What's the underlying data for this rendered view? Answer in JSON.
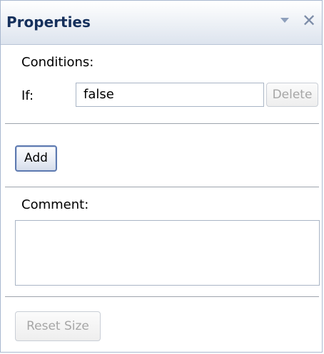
{
  "panel": {
    "title": "Properties"
  },
  "conditions": {
    "heading": "Conditions:",
    "if_label": "If:",
    "if_value": "false",
    "delete_label": "Delete"
  },
  "actions": {
    "add_label": "Add"
  },
  "comment": {
    "heading": "Comment:",
    "value": ""
  },
  "footer": {
    "reset_size_label": "Reset Size"
  },
  "icons": {
    "pin": "dropdown-arrow-icon",
    "close": "close-icon"
  }
}
